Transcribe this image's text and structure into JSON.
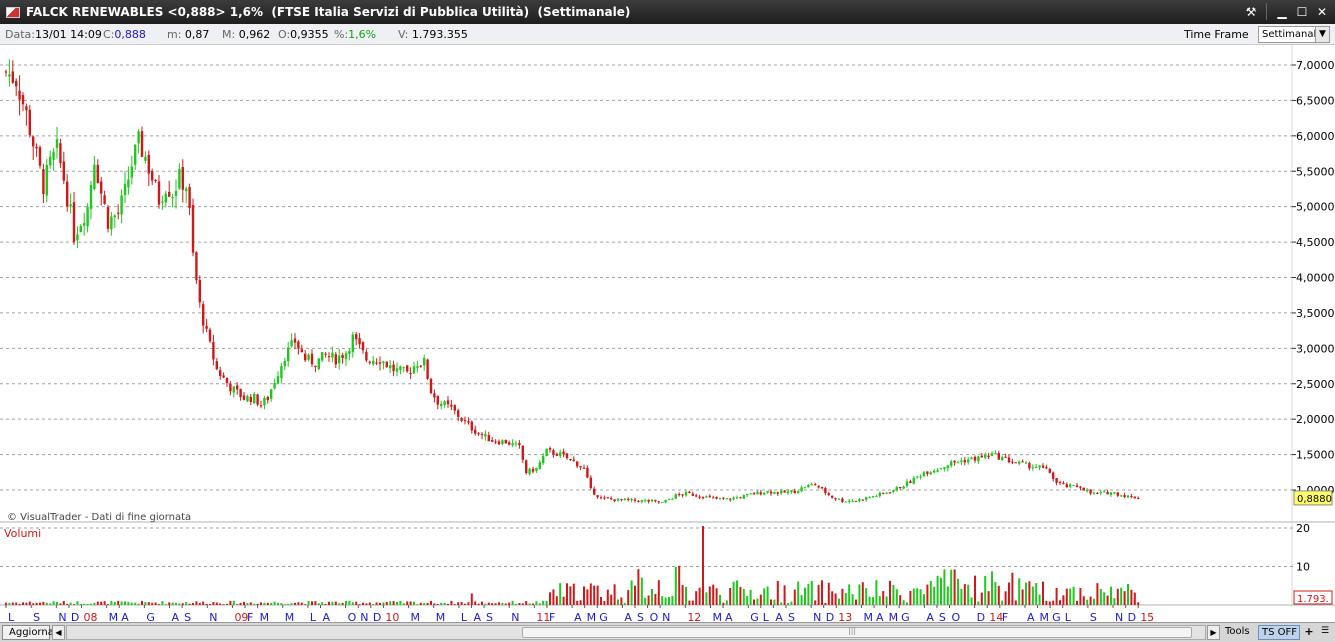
{
  "window": {
    "title": "FALCK RENEWABLES <0,888> 1,6%  (FTSE Italia Servizi di Pubblica Utilità)  (Settimanale)"
  },
  "infobar": {
    "data_label": "Data:",
    "data_value": "13/01 14:09",
    "c_label": "C:",
    "c_value": "0,888",
    "m_label": "m:",
    "m_value": "0,87",
    "M_label": "M:",
    "M_value": "0,962",
    "O_label": "O:",
    "O_value": "0,9355",
    "pct_label": "%:",
    "pct_value": "1,6%",
    "V_label": "V:",
    "V_value": "1.793.355",
    "timeframe_label": "Time Frame",
    "timeframe_value": "Settimanale"
  },
  "chart": {
    "watermark": "© VisualTrader - Dati di fine giornata",
    "price_axis_labels": [
      "7,0000",
      "6,5000",
      "6,0000",
      "5,5000",
      "5,0000",
      "4,5000",
      "4,0000",
      "3,5000",
      "3,0000",
      "2,5000",
      "2,0000",
      "1,5000",
      "1,0000"
    ],
    "price_axis_values": [
      7.0,
      6.5,
      6.0,
      5.5,
      5.0,
      4.5,
      4.0,
      3.5,
      3.0,
      2.5,
      2.0,
      1.5,
      1.0
    ],
    "last_price_tag": "0,8880",
    "last_price": 0.888,
    "volume_title": "Volumi",
    "volume_axis_labels": [
      "20",
      "10"
    ],
    "volume_axis_values": [
      20,
      10
    ],
    "last_volume_tag": "1.793.",
    "x_labels": [
      {
        "t": "L",
        "c": "blue",
        "w": 0
      },
      {
        "t": "S",
        "c": "blue",
        "w": 8
      },
      {
        "t": "N",
        "c": "blue",
        "w": 16
      },
      {
        "t": "D",
        "c": "blue",
        "w": 20
      },
      {
        "t": "08",
        "c": "red",
        "w": 24
      },
      {
        "t": "M",
        "c": "blue",
        "w": 32
      },
      {
        "t": "A",
        "c": "blue",
        "w": 36
      },
      {
        "t": "G",
        "c": "blue",
        "w": 44
      },
      {
        "t": "A",
        "c": "blue",
        "w": 52
      },
      {
        "t": "S",
        "c": "blue",
        "w": 56
      },
      {
        "t": "N",
        "c": "blue",
        "w": 64
      },
      {
        "t": "09",
        "c": "red",
        "w": 72
      },
      {
        "t": "F",
        "c": "blue",
        "w": 76
      },
      {
        "t": "M",
        "c": "blue",
        "w": 80
      },
      {
        "t": "M",
        "c": "blue",
        "w": 88
      },
      {
        "t": "L",
        "c": "blue",
        "w": 96
      },
      {
        "t": "A",
        "c": "blue",
        "w": 100
      },
      {
        "t": "O",
        "c": "blue",
        "w": 108
      },
      {
        "t": "N",
        "c": "blue",
        "w": 112
      },
      {
        "t": "D",
        "c": "blue",
        "w": 116
      },
      {
        "t": "10",
        "c": "red",
        "w": 120
      },
      {
        "t": "M",
        "c": "blue",
        "w": 128
      },
      {
        "t": "M",
        "c": "blue",
        "w": 136
      },
      {
        "t": "L",
        "c": "blue",
        "w": 144
      },
      {
        "t": "A",
        "c": "blue",
        "w": 148
      },
      {
        "t": "S",
        "c": "blue",
        "w": 152
      },
      {
        "t": "N",
        "c": "blue",
        "w": 160
      },
      {
        "t": "11",
        "c": "red",
        "w": 168
      },
      {
        "t": "F",
        "c": "blue",
        "w": 172
      },
      {
        "t": "A",
        "c": "blue",
        "w": 180
      },
      {
        "t": "M",
        "c": "blue",
        "w": 184
      },
      {
        "t": "G",
        "c": "blue",
        "w": 188
      },
      {
        "t": "A",
        "c": "blue",
        "w": 196
      },
      {
        "t": "S",
        "c": "blue",
        "w": 200
      },
      {
        "t": "O",
        "c": "blue",
        "w": 204
      },
      {
        "t": "N",
        "c": "blue",
        "w": 208
      },
      {
        "t": "12",
        "c": "red",
        "w": 216
      },
      {
        "t": "M",
        "c": "blue",
        "w": 224
      },
      {
        "t": "A",
        "c": "blue",
        "w": 228
      },
      {
        "t": "G",
        "c": "blue",
        "w": 236
      },
      {
        "t": "L",
        "c": "blue",
        "w": 240
      },
      {
        "t": "A",
        "c": "blue",
        "w": 244
      },
      {
        "t": "S",
        "c": "blue",
        "w": 248
      },
      {
        "t": "N",
        "c": "blue",
        "w": 256
      },
      {
        "t": "D",
        "c": "blue",
        "w": 260
      },
      {
        "t": "13",
        "c": "red",
        "w": 264
      },
      {
        "t": "M",
        "c": "blue",
        "w": 272
      },
      {
        "t": "A",
        "c": "blue",
        "w": 276
      },
      {
        "t": "M",
        "c": "blue",
        "w": 280
      },
      {
        "t": "G",
        "c": "blue",
        "w": 284
      },
      {
        "t": "A",
        "c": "blue",
        "w": 292
      },
      {
        "t": "S",
        "c": "blue",
        "w": 296
      },
      {
        "t": "O",
        "c": "blue",
        "w": 300
      },
      {
        "t": "D",
        "c": "blue",
        "w": 308
      },
      {
        "t": "14",
        "c": "red",
        "w": 312
      },
      {
        "t": "F",
        "c": "blue",
        "w": 316
      },
      {
        "t": "A",
        "c": "blue",
        "w": 324
      },
      {
        "t": "M",
        "c": "blue",
        "w": 328
      },
      {
        "t": "G",
        "c": "blue",
        "w": 332
      },
      {
        "t": "L",
        "c": "blue",
        "w": 336
      },
      {
        "t": "S",
        "c": "blue",
        "w": 344
      },
      {
        "t": "N",
        "c": "blue",
        "w": 352
      },
      {
        "t": "D",
        "c": "blue",
        "w": 356
      },
      {
        "t": "15",
        "c": "red",
        "w": 360
      }
    ],
    "colors": {
      "up": "#1ec81e",
      "down": "#d01818",
      "grid": "#a0a0a0",
      "tag_bg": "#ffff66"
    }
  },
  "chart_data": {
    "type": "candlestick",
    "weeks": 363,
    "close_anchors": [
      [
        0,
        6.9
      ],
      [
        3,
        6.8
      ],
      [
        6,
        6.3
      ],
      [
        9,
        5.7
      ],
      [
        11,
        5.3
      ],
      [
        13,
        5.6
      ],
      [
        15,
        5.8
      ],
      [
        17,
        5.4
      ],
      [
        19,
        4.9
      ],
      [
        20,
        4.6
      ],
      [
        22,
        4.8
      ],
      [
        24,
        5.0
      ],
      [
        26,
        5.7
      ],
      [
        28,
        5.2
      ],
      [
        30,
        4.8
      ],
      [
        33,
        4.9
      ],
      [
        35,
        5.2
      ],
      [
        37,
        5.6
      ],
      [
        39,
        5.9
      ],
      [
        41,
        5.7
      ],
      [
        43,
        5.4
      ],
      [
        45,
        5.1
      ],
      [
        47,
        5.3
      ],
      [
        49,
        5.2
      ],
      [
        51,
        5.4
      ],
      [
        53,
        5.3
      ],
      [
        54,
        4.9
      ],
      [
        55,
        4.3
      ],
      [
        57,
        3.6
      ],
      [
        59,
        3.2
      ],
      [
        62,
        2.7
      ],
      [
        66,
        2.45
      ],
      [
        70,
        2.3
      ],
      [
        73,
        2.3
      ],
      [
        75,
        2.2
      ],
      [
        77,
        2.3
      ],
      [
        79,
        2.55
      ],
      [
        82,
        2.9
      ],
      [
        85,
        3.1
      ],
      [
        88,
        2.85
      ],
      [
        91,
        2.8
      ],
      [
        94,
        2.9
      ],
      [
        97,
        2.85
      ],
      [
        100,
        2.95
      ],
      [
        102,
        3.15
      ],
      [
        104,
        3.0
      ],
      [
        106,
        2.85
      ],
      [
        110,
        2.85
      ],
      [
        114,
        2.7
      ],
      [
        118,
        2.65
      ],
      [
        121,
        2.8
      ],
      [
        123,
        2.8
      ],
      [
        125,
        2.4
      ],
      [
        127,
        2.25
      ],
      [
        131,
        2.15
      ],
      [
        135,
        1.95
      ],
      [
        139,
        1.8
      ],
      [
        143,
        1.7
      ],
      [
        147,
        1.68
      ],
      [
        151,
        1.6
      ],
      [
        153,
        1.25
      ],
      [
        156,
        1.3
      ],
      [
        159,
        1.55
      ],
      [
        163,
        1.5
      ],
      [
        167,
        1.4
      ],
      [
        170,
        1.3
      ],
      [
        172,
        1.0
      ],
      [
        175,
        0.88
      ],
      [
        180,
        0.86
      ],
      [
        185,
        0.85
      ],
      [
        190,
        0.84
      ],
      [
        193,
        0.82
      ],
      [
        197,
        0.92
      ],
      [
        200,
        0.95
      ],
      [
        204,
        0.92
      ],
      [
        208,
        0.88
      ],
      [
        212,
        0.87
      ],
      [
        216,
        0.9
      ],
      [
        220,
        0.95
      ],
      [
        224,
        0.98
      ],
      [
        228,
        0.96
      ],
      [
        232,
        0.98
      ],
      [
        235,
        1.05
      ],
      [
        238,
        1.08
      ],
      [
        240,
        1.0
      ],
      [
        243,
        0.9
      ],
      [
        246,
        0.85
      ],
      [
        250,
        0.85
      ],
      [
        254,
        0.9
      ],
      [
        258,
        0.95
      ],
      [
        262,
        1.02
      ],
      [
        266,
        1.12
      ],
      [
        270,
        1.25
      ],
      [
        274,
        1.3
      ],
      [
        278,
        1.38
      ],
      [
        282,
        1.42
      ],
      [
        286,
        1.45
      ],
      [
        290,
        1.5
      ],
      [
        293,
        1.45
      ],
      [
        296,
        1.4
      ],
      [
        300,
        1.35
      ],
      [
        304,
        1.32
      ],
      [
        307,
        1.25
      ],
      [
        309,
        1.1
      ],
      [
        312,
        1.05
      ],
      [
        316,
        1.05
      ],
      [
        319,
        0.95
      ],
      [
        322,
        0.95
      ],
      [
        325,
        0.97
      ],
      [
        328,
        0.93
      ],
      [
        331,
        0.9
      ],
      [
        333,
        0.89
      ]
    ],
    "price_range": [
      0.75,
      7.3
    ],
    "volume_range": [
      0,
      21
    ]
  }
}
